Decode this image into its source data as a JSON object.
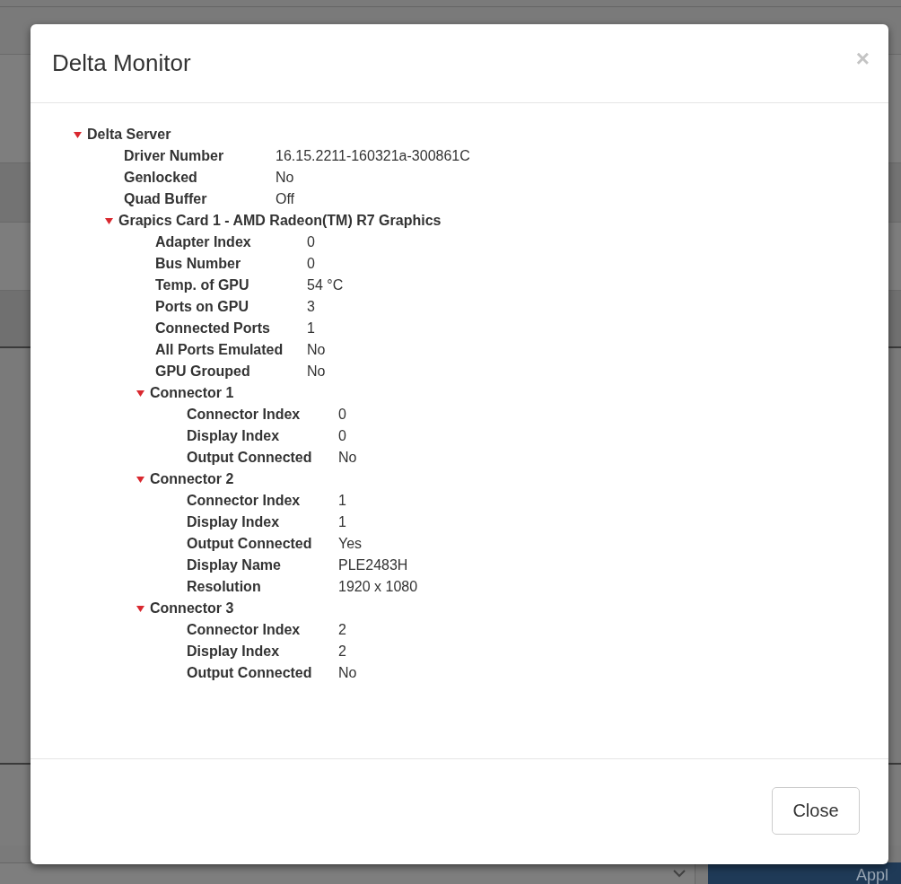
{
  "background": {
    "apply_button": "Appl"
  },
  "dialog": {
    "title": "Delta Monitor",
    "close_icon": "×",
    "tree": [
      {
        "label": "Delta Server",
        "expanded": true,
        "fields": [
          {
            "label": "Driver Number",
            "value": "16.15.2211-160321a-300861C"
          },
          {
            "label": "Genlocked",
            "value": "No"
          },
          {
            "label": "Quad Buffer",
            "value": "Off"
          }
        ],
        "children": [
          {
            "label": "Grapics Card 1 - AMD Radeon(TM) R7 Graphics",
            "expanded": true,
            "fields": [
              {
                "label": "Adapter Index",
                "value": "0"
              },
              {
                "label": "Bus Number",
                "value": "0"
              },
              {
                "label": "Temp. of GPU",
                "value": "54 °C"
              },
              {
                "label": "Ports on GPU",
                "value": "3"
              },
              {
                "label": "Connected Ports",
                "value": "1"
              },
              {
                "label": "All Ports Emulated",
                "value": "No"
              },
              {
                "label": "GPU Grouped",
                "value": "No"
              }
            ],
            "children": [
              {
                "label": "Connector 1",
                "expanded": true,
                "fields": [
                  {
                    "label": "Connector Index",
                    "value": "0"
                  },
                  {
                    "label": "Display Index",
                    "value": "0"
                  },
                  {
                    "label": "Output Connected",
                    "value": "No"
                  }
                ]
              },
              {
                "label": "Connector 2",
                "expanded": true,
                "fields": [
                  {
                    "label": "Connector Index",
                    "value": "1"
                  },
                  {
                    "label": "Display Index",
                    "value": "1"
                  },
                  {
                    "label": "Output Connected",
                    "value": "Yes"
                  },
                  {
                    "label": "Display Name",
                    "value": "PLE2483H"
                  },
                  {
                    "label": "Resolution",
                    "value": "1920 x 1080"
                  }
                ]
              },
              {
                "label": "Connector 3",
                "expanded": true,
                "fields": [
                  {
                    "label": "Connector Index",
                    "value": "2"
                  },
                  {
                    "label": "Display Index",
                    "value": "2"
                  },
                  {
                    "label": "Output Connected",
                    "value": "No"
                  }
                ]
              }
            ]
          }
        ]
      }
    ],
    "footer_button": "Close"
  }
}
